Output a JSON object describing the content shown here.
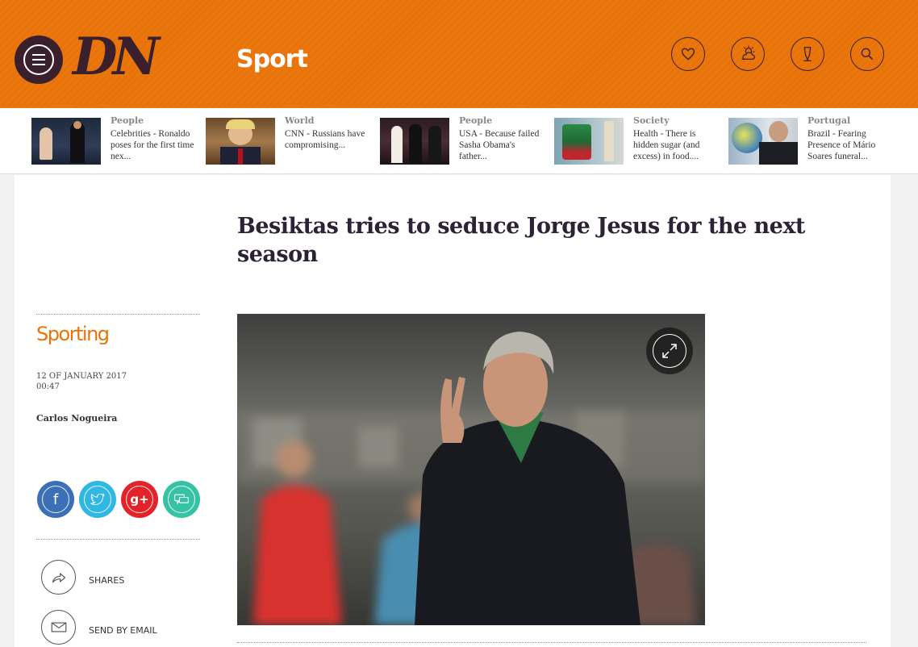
{
  "header": {
    "logo": "DN",
    "section": "Sport",
    "colors": {
      "brand": "#e87308",
      "dark": "#3a1f2d"
    },
    "icons": [
      "menu-icon",
      "heart-icon",
      "weather-icon",
      "pen-icon",
      "search-icon"
    ]
  },
  "teasers": [
    {
      "category": "People",
      "title": "Celebrities - Ronaldo poses for the first time nex..."
    },
    {
      "category": "World",
      "title": "CNN - Russians have compromising..."
    },
    {
      "category": "People",
      "title": "USA - Because failed Sasha Obama's father..."
    },
    {
      "category": "Society",
      "title": "Health - There is hidden sugar (and excess) in food...."
    },
    {
      "category": "Portugal",
      "title": "Brazil - Fearing Presence of Mário Soares funeral..."
    }
  ],
  "article": {
    "headline": "Besiktas tries to seduce Jorge Jesus for the next season",
    "tag": "Sporting",
    "date": "12 OF JANUARY 2017",
    "time": "00:47",
    "author": "Carlos Nogueira"
  },
  "social": [
    {
      "name": "facebook",
      "glyph": "f",
      "color": "#3b6fb6"
    },
    {
      "name": "twitter",
      "glyph": "",
      "color": "#2fb8e3"
    },
    {
      "name": "google-plus",
      "glyph": "g+",
      "color": "#e2232a"
    },
    {
      "name": "comments",
      "glyph": "",
      "color": "#36c3a5"
    }
  ],
  "actions": {
    "shares": "SHARES",
    "email": "SEND BY EMAIL"
  }
}
